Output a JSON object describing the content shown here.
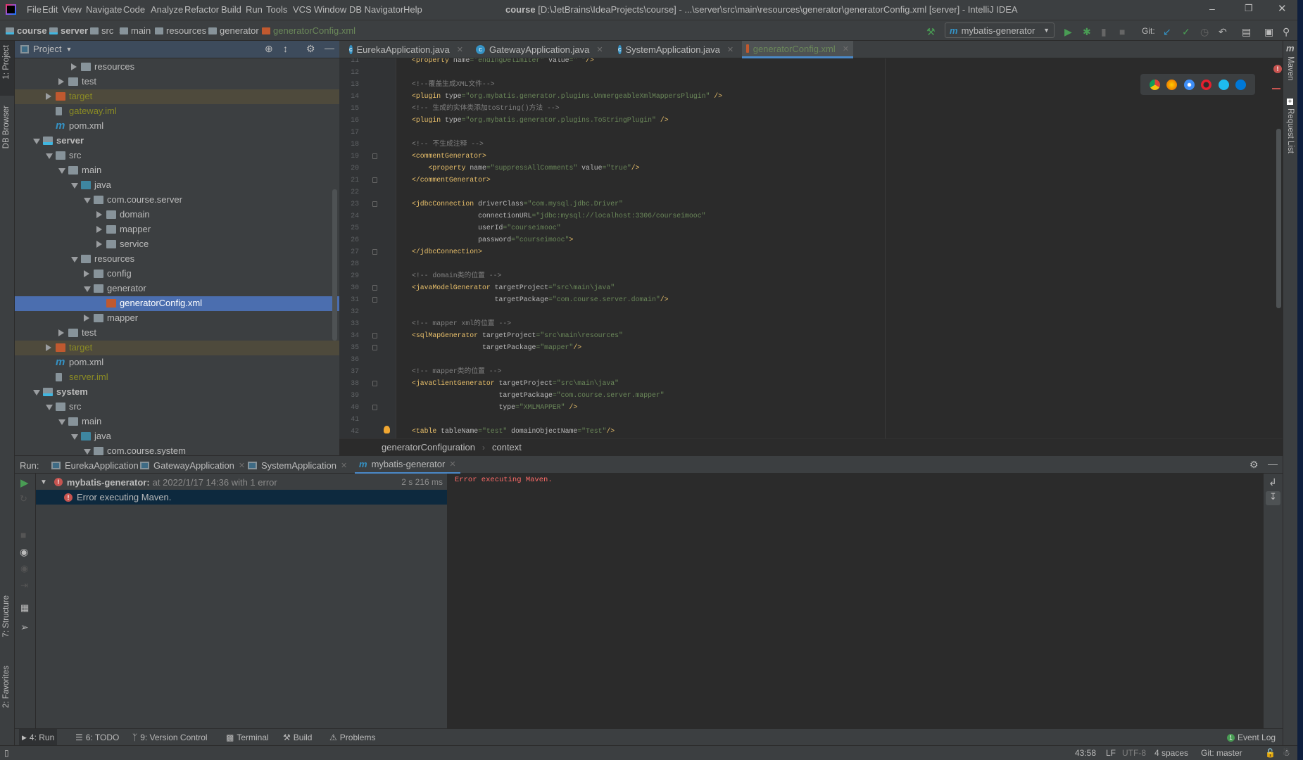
{
  "title_bar": {
    "menu": [
      "File",
      "Edit",
      "View",
      "Navigate",
      "Code",
      "Analyze",
      "Refactor",
      "Build",
      "Run",
      "Tools",
      "VCS",
      "Window",
      "DB Navigator",
      "Help"
    ],
    "project_name": "course",
    "title": "[D:\\JetBrains\\IdeaProjects\\course] - ...\\server\\src\\main\\resources\\generator\\generatorConfig.xml [server] - IntelliJ IDEA"
  },
  "nav_bar": {
    "breadcrumbs": [
      "course",
      "server",
      "src",
      "main",
      "resources",
      "generator",
      "generatorConfig.xml"
    ],
    "run_config": "mybatis-generator",
    "git_label": "Git:"
  },
  "left_strip": {
    "project": "1: Project",
    "db_browser": "DB Browser",
    "structure": "7: Structure",
    "favorites": "2: Favorites"
  },
  "right_strip": {
    "maven": "Maven",
    "request_list": "Request List"
  },
  "project_panel": {
    "title": "Project",
    "items": [
      {
        "label": "resources",
        "level": 3,
        "state": "closed",
        "icon": "res"
      },
      {
        "label": "test",
        "level": 2,
        "state": "closed",
        "icon": "folder"
      },
      {
        "label": "target",
        "level": 1,
        "state": "closed",
        "icon": "excluded",
        "style": "excluded"
      },
      {
        "label": "gateway.iml",
        "level": 1,
        "icon": "iml",
        "style": "olive"
      },
      {
        "label": "pom.xml",
        "level": 1,
        "icon": "maven"
      },
      {
        "label": "server",
        "level": 0,
        "state": "open",
        "icon": "module",
        "style": "bold"
      },
      {
        "label": "src",
        "level": 1,
        "state": "open",
        "icon": "folder"
      },
      {
        "label": "main",
        "level": 2,
        "state": "open",
        "icon": "folder"
      },
      {
        "label": "java",
        "level": 3,
        "state": "open",
        "icon": "src"
      },
      {
        "label": "com.course.server",
        "level": 4,
        "state": "open",
        "icon": "package"
      },
      {
        "label": "domain",
        "level": 5,
        "state": "closed",
        "icon": "package"
      },
      {
        "label": "mapper",
        "level": 5,
        "state": "closed",
        "icon": "package"
      },
      {
        "label": "service",
        "level": 5,
        "state": "closed",
        "icon": "package"
      },
      {
        "label": "resources",
        "level": 3,
        "state": "open",
        "icon": "res"
      },
      {
        "label": "config",
        "level": 4,
        "state": "closed",
        "icon": "package"
      },
      {
        "label": "generator",
        "level": 4,
        "state": "open",
        "icon": "package"
      },
      {
        "label": "generatorConfig.xml",
        "level": 5,
        "icon": "xml",
        "style": "selected"
      },
      {
        "label": "mapper",
        "level": 4,
        "state": "closed",
        "icon": "package"
      },
      {
        "label": "test",
        "level": 2,
        "state": "closed",
        "icon": "folder"
      },
      {
        "label": "target",
        "level": 1,
        "state": "closed",
        "icon": "excluded",
        "style": "excluded"
      },
      {
        "label": "pom.xml",
        "level": 1,
        "icon": "maven"
      },
      {
        "label": "server.iml",
        "level": 1,
        "icon": "iml",
        "style": "olive"
      },
      {
        "label": "system",
        "level": 0,
        "state": "open",
        "icon": "module",
        "style": "bold"
      },
      {
        "label": "src",
        "level": 1,
        "state": "open",
        "icon": "folder"
      },
      {
        "label": "main",
        "level": 2,
        "state": "open",
        "icon": "folder"
      },
      {
        "label": "java",
        "level": 3,
        "state": "open",
        "icon": "src"
      },
      {
        "label": "com.course.system",
        "level": 4,
        "state": "open",
        "icon": "package"
      }
    ]
  },
  "editor": {
    "tabs": [
      {
        "label": "EurekaApplication.java",
        "active": false
      },
      {
        "label": "GatewayApplication.java",
        "active": false
      },
      {
        "label": "SystemApplication.java",
        "active": false
      },
      {
        "label": "generatorConfig.xml",
        "active": true
      }
    ],
    "first_line": 11,
    "lines": [
      "<property name=\"endingDelimiter\" value=\"`\"/>",
      "",
      "<!--覆盖生成XML文件-->",
      "<plugin type=\"org.mybatis.generator.plugins.UnmergeableXmlMappersPlugin\" />",
      "<!-- 生成的实体类添加toString()方法 -->",
      "<plugin type=\"org.mybatis.generator.plugins.ToStringPlugin\" />",
      "",
      "<!-- 不生成注释 -->",
      "<commentGenerator>",
      "    <property name=\"suppressAllComments\" value=\"true\"/>",
      "</commentGenerator>",
      "",
      "<jdbcConnection driverClass=\"com.mysql.jdbc.Driver\"",
      "                connectionURL=\"jdbc:mysql://localhost:3306/courseimooc\"",
      "                userId=\"courseimooc\"",
      "                password=\"courseimooc\">",
      "</jdbcConnection>",
      "",
      "<!-- domain类的位置 -->",
      "<javaModelGenerator targetProject=\"src\\main\\java\"",
      "                    targetPackage=\"com.course.server.domain\"/>",
      "",
      "<!-- mapper xml的位置 -->",
      "<sqlMapGenerator targetProject=\"src\\main\\resources\"",
      "                 targetPackage=\"mapper\"/>",
      "",
      "<!-- mapper类的位置 -->",
      "<javaClientGenerator targetProject=\"src\\main\\java\"",
      "                     targetPackage=\"com.course.server.mapper\"",
      "                     type=\"XMLMAPPER\" />",
      "",
      "<table tableName=\"test\" domainObjectName=\"Test\"/>"
    ],
    "fold_lines": [
      19,
      21,
      23,
      27,
      30,
      31,
      34,
      35,
      38,
      40
    ],
    "bulb_line": 42,
    "breadcrumb": [
      "generatorConfiguration",
      "context"
    ],
    "browser_icons": [
      "chrome-icon",
      "firefox-icon",
      "safari-icon",
      "opera-icon",
      "ie-icon",
      "edge-icon"
    ]
  },
  "run_panel": {
    "label": "Run:",
    "tabs": [
      {
        "label": "EurekaApplication",
        "active": false
      },
      {
        "label": "GatewayApplication",
        "active": false
      },
      {
        "label": "SystemApplication",
        "active": false
      },
      {
        "label": "mybatis-generator",
        "active": true
      }
    ],
    "tree": {
      "root_name": "mybatis-generator:",
      "root_detail": "at 2022/1/17 14:36 with 1 error",
      "duration": "2 s 216 ms",
      "child": "Error executing Maven."
    },
    "console": "Error executing Maven."
  },
  "bottom_tools": [
    "4: Run",
    "6: TODO",
    "9: Version Control",
    "Terminal",
    "Build",
    "Problems"
  ],
  "event_log": "Event Log",
  "status_bar": {
    "position": "43:58",
    "line_sep": "LF",
    "encoding": "UTF-8",
    "indent": "4 spaces",
    "git": "Git: master"
  },
  "colors": {
    "accent": "#4b6eaf",
    "tag": "#e8bf6a",
    "value": "#6a8759",
    "comment": "#808080",
    "error": "#ff6b68",
    "run_green": "#499c54"
  }
}
